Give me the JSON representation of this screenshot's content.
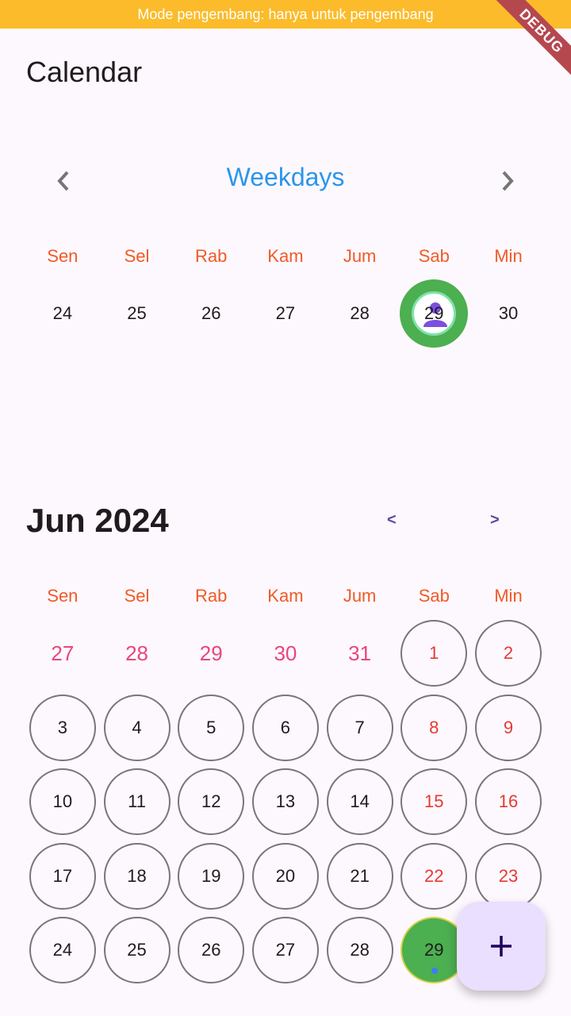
{
  "status_bar": {
    "dev_mode_text": "Mode pengembang: hanya untuk pengembang"
  },
  "debug_banner": "DEBUG",
  "app_bar": {
    "title": "Calendar"
  },
  "week_view": {
    "title": "Weekdays",
    "prev_icon": "chevron-left-icon",
    "next_icon": "chevron-right-icon",
    "day_names": [
      "Sen",
      "Sel",
      "Rab",
      "Kam",
      "Jum",
      "Sab",
      "Min"
    ],
    "dates": [
      "24",
      "25",
      "26",
      "27",
      "28",
      "29",
      "30"
    ],
    "today_index": 5
  },
  "month_view": {
    "title": "Jun 2024",
    "prev_label": "<",
    "next_label": ">",
    "day_names": [
      "Sen",
      "Sel",
      "Rab",
      "Kam",
      "Jum",
      "Sab",
      "Min"
    ],
    "weeks": [
      [
        "27",
        "28",
        "29",
        "30",
        "31",
        "1",
        "2"
      ],
      [
        "3",
        "4",
        "5",
        "6",
        "7",
        "8",
        "9"
      ],
      [
        "10",
        "11",
        "12",
        "13",
        "14",
        "15",
        "16"
      ],
      [
        "17",
        "18",
        "19",
        "20",
        "21",
        "22",
        "23"
      ],
      [
        "24",
        "25",
        "26",
        "27",
        "28",
        "29",
        ""
      ]
    ],
    "selected_date": "29"
  },
  "fab": {
    "icon": "plus-icon",
    "label": "+"
  },
  "colors": {
    "accent_blue": "#2b96ea",
    "day_name_orange": "#f05a28",
    "weekend_red": "#e53935",
    "prev_month_pink": "#e8467c",
    "today_green": "#4caf50",
    "fab_bg": "#eadffe"
  }
}
